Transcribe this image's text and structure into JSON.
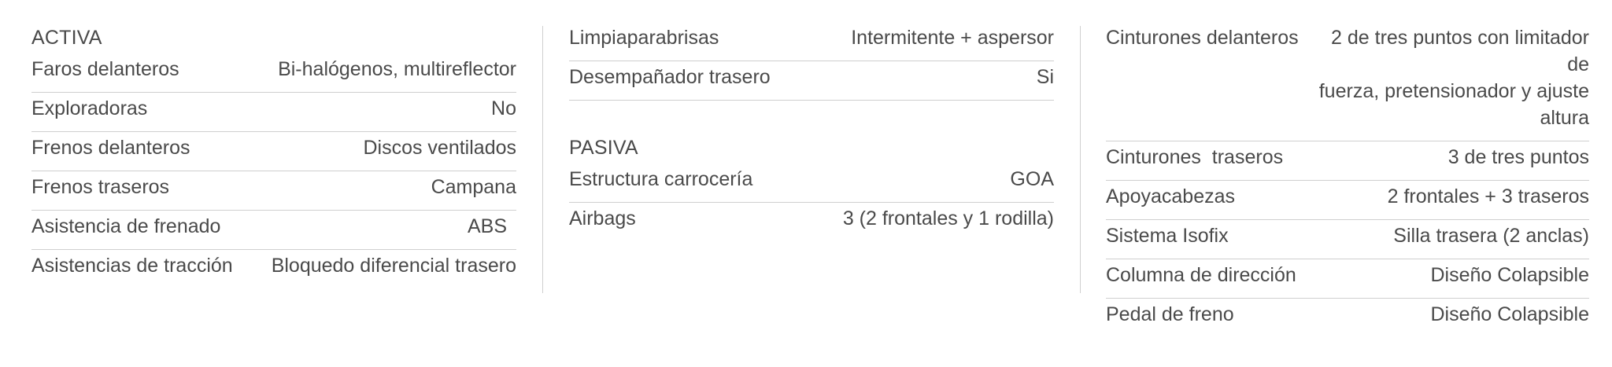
{
  "activa": {
    "title": "ACTIVA",
    "rows": [
      {
        "label": "Faros delanteros",
        "value": "Bi-halógenos, multireflector"
      },
      {
        "label": "Exploradoras",
        "value": "No"
      },
      {
        "label": "Frenos delanteros",
        "value": "Discos ventilados"
      },
      {
        "label": "Frenos traseros",
        "value": "Campana"
      },
      {
        "label": "Asistencia de frenado",
        "value": "ABS"
      },
      {
        "label": "Asistencias de tracción",
        "value": "Bloquedo diferencial trasero"
      }
    ]
  },
  "middle": {
    "rows": [
      {
        "label": "Limpiaparabrisas",
        "value": "Intermitente + aspersor"
      },
      {
        "label": "Desempañador trasero",
        "value": "Si"
      }
    ]
  },
  "pasiva": {
    "title": "PASIVA",
    "rows": [
      {
        "label": "Estructura carrocería",
        "value": "GOA"
      },
      {
        "label": "Airbags",
        "value": "3 (2 frontales y 1 rodilla)"
      }
    ]
  },
  "right": {
    "rows": [
      {
        "label": "Cinturones delanteros",
        "value_line1": "2 de tres puntos con limitador de",
        "value_line2": "fuerza, pretensionador y ajuste altura"
      },
      {
        "label": "Cinturones  traseros",
        "value": "3 de tres puntos"
      },
      {
        "label": "Apoyacabezas",
        "value": "2 frontales + 3 traseros"
      },
      {
        "label": "Sistema Isofix",
        "value": "Silla trasera (2 anclas)"
      },
      {
        "label": "Columna de dirección",
        "value": "Diseño Colapsible"
      },
      {
        "label": "Pedal de freno",
        "value": "Diseño Colapsible"
      }
    ]
  }
}
